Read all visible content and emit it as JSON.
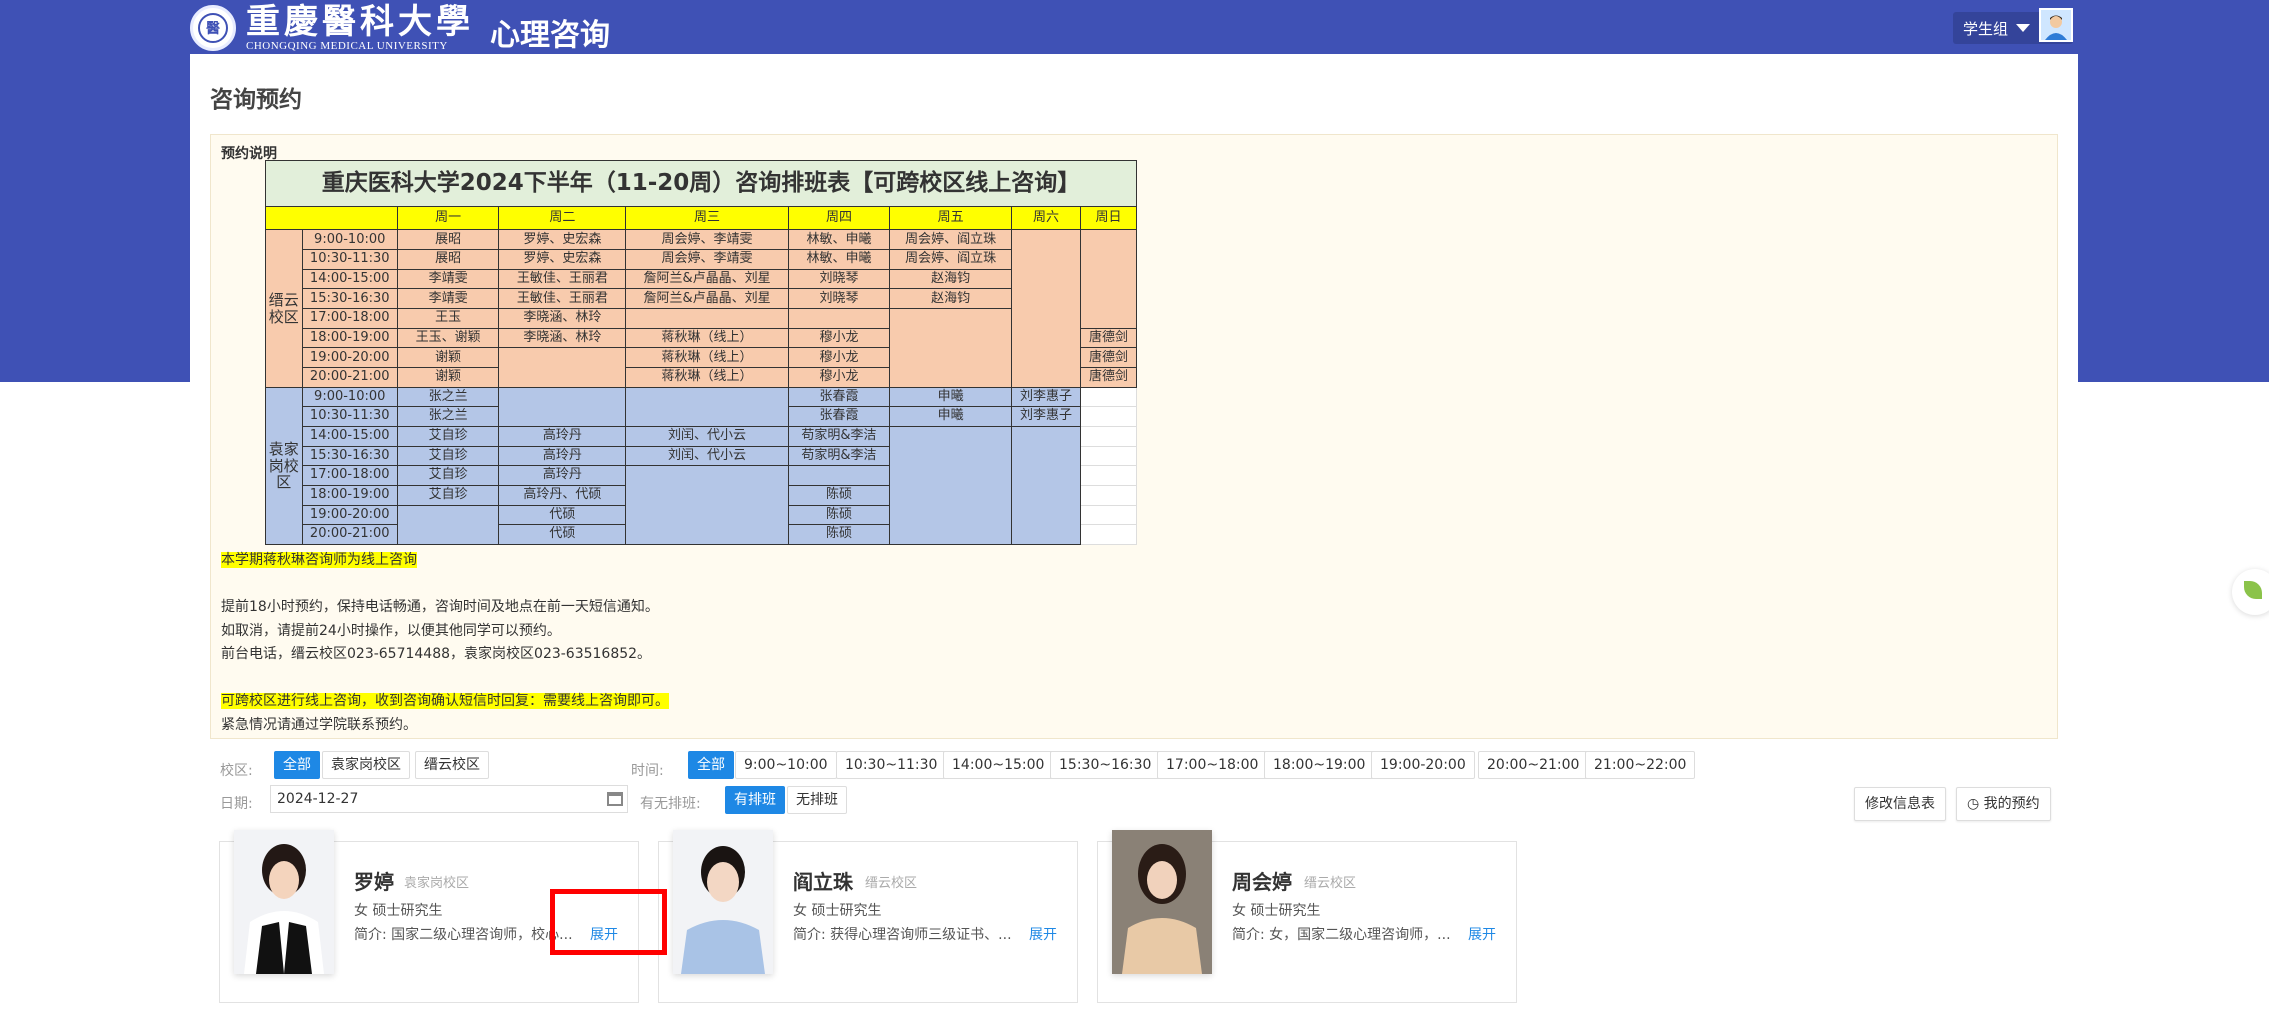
{
  "header": {
    "logo_cn": "重慶醫科大學",
    "logo_en": "CHONGQING MEDICAL UNIVERSITY",
    "system_title": "心理咨询",
    "user_group": "学生组"
  },
  "page_title": "咨询预约",
  "notice": {
    "title": "预约说明",
    "schedule": {
      "title": "重庆医科大学2024下半年（11-20周）咨询排班表【可跨校区线上咨询】",
      "days": [
        "周一",
        "周二",
        "周三",
        "周四",
        "周五",
        "周六",
        "周日"
      ],
      "campus_a": "缙云校区",
      "campus_b": "袁家岗校区",
      "times_a": [
        "9:00-10:00",
        "10:30-11:30",
        "14:00-15:00",
        "15:30-16:30",
        "17:00-18:00",
        "18:00-19:00",
        "19:00-20:00",
        "20:00-21:00"
      ],
      "times_b": [
        "9:00-10:00",
        "10:30-11:30",
        "14:00-15:00",
        "15:30-16:30",
        "17:00-18:00",
        "18:00-19:00",
        "19:00-20:00",
        "20:00-21:00"
      ],
      "a_mon": [
        "展昭",
        "展昭",
        "李靖雯",
        "李靖雯",
        "王玉",
        "王玉、谢颖",
        "谢颖",
        "谢颖"
      ],
      "a_tue": [
        "罗婷、史宏森",
        "罗婷、史宏森",
        "王敏佳、王丽君",
        "王敏佳、王丽君",
        "李晓涵、林玲",
        "李晓涵、林玲"
      ],
      "a_wed": [
        "周会婷、李靖雯",
        "周会婷、李靖雯",
        "詹阿兰&卢晶晶、刘星",
        "詹阿兰&卢晶晶、刘星",
        "",
        "蒋秋琳（线上）",
        "蒋秋琳（线上）",
        "蒋秋琳（线上）"
      ],
      "a_thu": [
        "林敏、申曦",
        "林敏、申曦",
        "刘晓琴",
        "刘晓琴",
        "",
        "穆小龙",
        "穆小龙",
        "穆小龙"
      ],
      "a_fri": [
        "周会婷、阎立珠",
        "周会婷、阎立珠",
        "赵海钧",
        "赵海钧"
      ],
      "a_sun": [
        "唐德剑",
        "唐德剑",
        "唐德剑"
      ],
      "b_mon": [
        "张之兰",
        "张之兰",
        "艾自珍",
        "艾自珍",
        "艾自珍",
        "艾自珍"
      ],
      "b_tue": [
        "高玲丹",
        "高玲丹",
        "高玲丹",
        "高玲丹、代硕",
        "代硕",
        "代硕"
      ],
      "b_wed": [
        "刘闰、代小云",
        "刘闰、代小云"
      ],
      "b_thu": [
        "张春霞",
        "张春霞",
        "苟家明&李洁",
        "苟家明&李洁",
        "",
        "陈硕",
        "陈硕",
        "陈硕"
      ],
      "b_fri": [
        "申曦",
        "申曦"
      ],
      "b_sat": [
        "刘李惠子",
        "刘李惠子"
      ]
    },
    "lines": [
      "本学期蒋秋琳咨询师为线上咨询",
      "",
      "提前18小时预约，保持电话畅通，咨询时间及地点在前一天短信通知。",
      "如取消，请提前24小时操作，以便其他同学可以预约。",
      "前台电话，缙云校区023-65714488，袁家岗校区023-63516852。",
      "",
      "可跨校区进行线上咨询，收到咨询确认短信时回复：需要线上咨询即可。",
      "紧急情况请通过学院联系预约。"
    ]
  },
  "filters": {
    "campus_label": "校区:",
    "campus_options": [
      "全部",
      "袁家岗校区",
      "缙云校区"
    ],
    "time_label": "时间:",
    "time_options": [
      "全部",
      "9:00~10:00",
      "10:30~11:30",
      "14:00~15:00",
      "15:30~16:30",
      "17:00~18:00",
      "18:00~19:00",
      "19:00-20:00",
      "20:00~21:00",
      "21:00~22:00"
    ],
    "date_label": "日期:",
    "date_value": "2024-12-27",
    "schedule_label": "有无排班:",
    "schedule_options": [
      "有排班",
      "无排班"
    ]
  },
  "actions": {
    "edit_info": "修改信息表",
    "my_booking": "我的预约"
  },
  "counselors": [
    {
      "name": "罗婷",
      "campus": "袁家岗校区",
      "meta": "女 硕士研究生",
      "intro": "简介: 国家二级心理咨询师，校心...",
      "expand": "展开"
    },
    {
      "name": "阎立珠",
      "campus": "缙云校区",
      "meta": "女 硕士研究生",
      "intro": "简介: 获得心理咨询师三级证书、...",
      "expand": "展开"
    },
    {
      "name": "周会婷",
      "campus": "缙云校区",
      "meta": "女 硕士研究生",
      "intro": "简介: 女，国家二级心理咨询师，...",
      "expand": "展开"
    }
  ],
  "colors": {
    "header_blue": "#3f51b5",
    "accent_blue": "#1e88e5",
    "highlight_red": "#ff0000"
  }
}
